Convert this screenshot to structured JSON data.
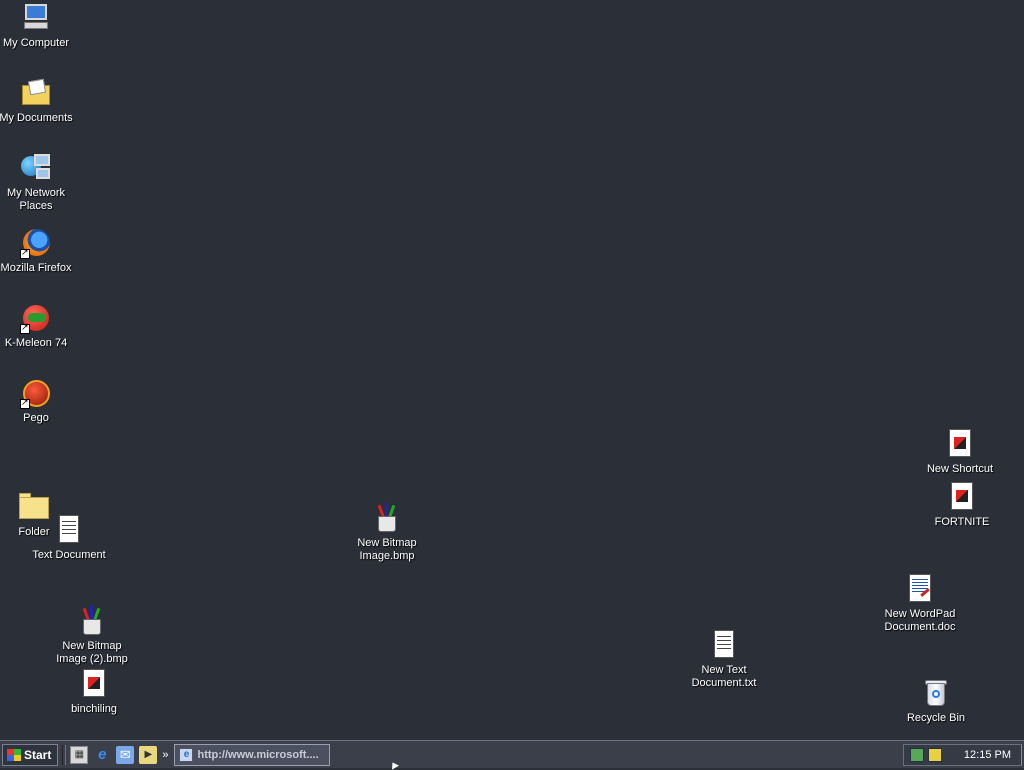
{
  "desktop": {
    "icons": [
      {
        "label": "My Computer"
      },
      {
        "label": "My Documents"
      },
      {
        "label": "My Network\nPlaces"
      },
      {
        "label": "Mozilla Firefox"
      },
      {
        "label": "K-Meleon 74"
      },
      {
        "label": "Pego"
      },
      {
        "label": "Folder"
      },
      {
        "label": "Text Document"
      },
      {
        "label": "New Bitmap\nImage.bmp"
      },
      {
        "label": "New Bitmap\nImage (2).bmp"
      },
      {
        "label": "binchiling"
      },
      {
        "label": "New Shortcut"
      },
      {
        "label": "FORTNITE"
      },
      {
        "label": "New WordPad\nDocument.doc"
      },
      {
        "label": "New Text\nDocument.txt"
      },
      {
        "label": "Recycle Bin"
      }
    ]
  },
  "taskbar": {
    "start_label": "Start",
    "quick_launch_more": "»",
    "active_task_label": "http://www.microsoft....",
    "clock": "12:15 PM"
  }
}
